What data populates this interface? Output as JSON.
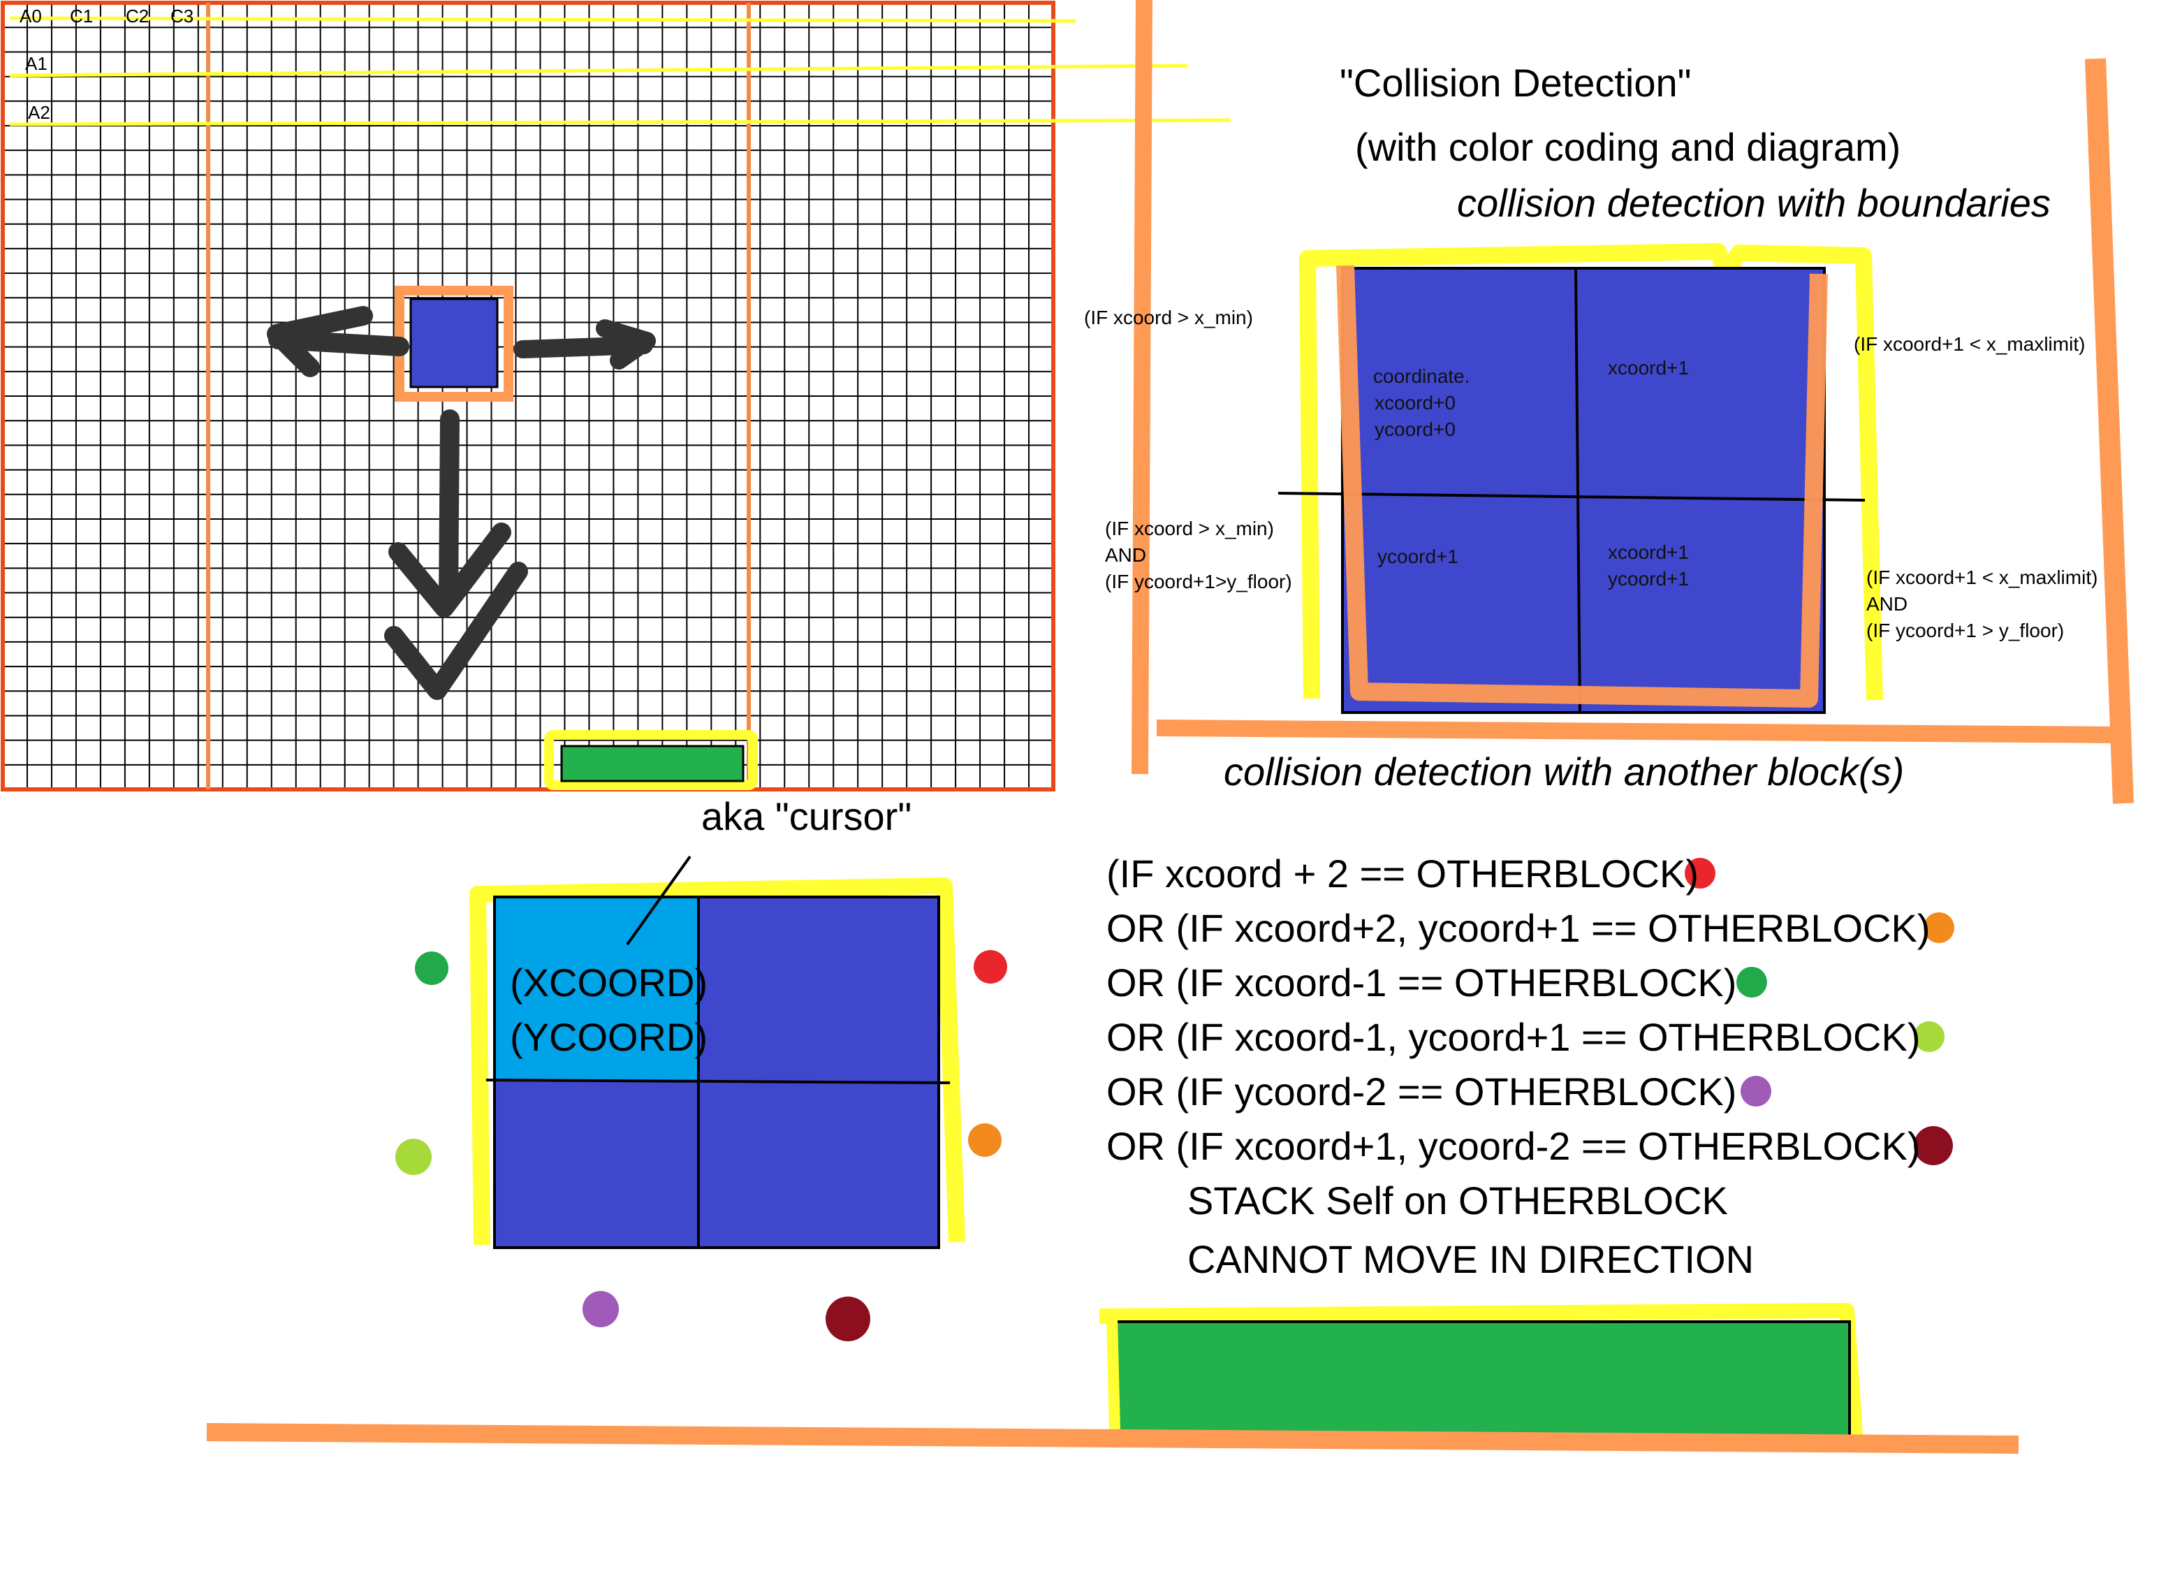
{
  "grid_labels": {
    "a0": "A0",
    "c1": "C1",
    "c2": "C2",
    "c3": "C3",
    "a1": "A1",
    "a2": "A2"
  },
  "titles": {
    "main": "\"Collision Detection\"",
    "sub": "(with color coding and diagram)",
    "boundaries": "collision detection with boundaries",
    "blocks": "collision detection with another block(s)"
  },
  "boundary_block": {
    "cell_tl": [
      "coordinate.",
      "xcoord+0",
      "ycoord+0"
    ],
    "cell_tr": "xcoord+1",
    "cell_bl": "ycoord+1",
    "cell_br": [
      "xcoord+1",
      "ycoord+1"
    ],
    "left_top_cond": "(IF xcoord > x_min)",
    "right_top_cond": "(IF xcoord+1 < x_maxlimit)",
    "left_bottom_cond": [
      "(IF xcoord > x_min)",
      "AND",
      "(IF ycoord+1>y_floor)"
    ],
    "right_bottom_cond": [
      "(IF xcoord+1 < x_maxlimit)",
      "AND",
      "(IF ycoord+1 > y_floor)"
    ]
  },
  "cursor_block": {
    "aka": "aka \"cursor\"",
    "xcoord": "(XCOORD)",
    "ycoord": "(YCOORD)"
  },
  "conditions": [
    {
      "text": "(IF xcoord + 2 == OTHERBLOCK)",
      "color": "#e8262b"
    },
    {
      "text": "OR (IF xcoord+2, ycoord+1 == OTHERBLOCK)",
      "color": "#f28a1e"
    },
    {
      "text": "OR (IF xcoord-1 == OTHERBLOCK)",
      "color": "#22a94a"
    },
    {
      "text": "OR (IF xcoord-1, ycoord+1 == OTHERBLOCK)",
      "color": "#a6d93a"
    },
    {
      "text": "OR (IF ycoord-2 == OTHERBLOCK)",
      "color": "#a05ab8"
    },
    {
      "text": "OR (IF xcoord+1, ycoord-2 == OTHERBLOCK)",
      "color": "#8b0f1e"
    }
  ],
  "results": [
    "STACK Self on OTHERBLOCK",
    "CANNOT MOVE IN DIRECTION"
  ],
  "colors": {
    "block_blue": "#3f48cc",
    "cursor_cyan": "#00a2e8",
    "ground_green": "#22b14c",
    "highlight_yellow": "#ffff33",
    "boundary_orange": "#ff9a55",
    "grid_border": "#ea4a1a"
  }
}
